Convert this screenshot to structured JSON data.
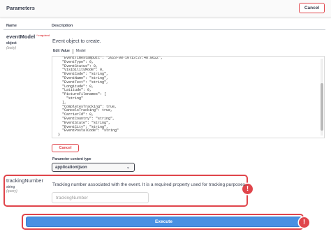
{
  "header": {
    "title": "Parameters",
    "cancel_label": "Cancel"
  },
  "columns": {
    "name": "Name",
    "description": "Description"
  },
  "event_model": {
    "name": "eventModel",
    "required_label": "* required",
    "type": "object",
    "in": "(body)",
    "description": "Event object to create.",
    "tabs": [
      "Edit Value",
      "Model"
    ],
    "code_lines": [
      "  \"EventTimestampUtc\": \"2023-08-10T13:27:48.862Z\",",
      "  \"EventType\": 0,",
      "  \"EventStatus\": 0,",
      "  \"VisibilityMode\": 0,",
      "  \"EventCode\": \"string\",",
      "  \"EventName\": \"string\",",
      "  \"EventText\": \"string\",",
      "  \"Longitude\": 0,",
      "  \"Latitude\": 0,",
      "  \"PictureFilenames\": [",
      "    \"string\"",
      "  ],",
      "  \"CompletesTracking\": true,",
      "  \"CancelsTracking\": true,",
      "  \"CarrierId\": 0,",
      "  \"EventCountry\": \"string\",",
      "  \"EventState\": \"string\",",
      "  \"EventCity\": \"string\",",
      "  \"EventPostalCode\": \"string\"",
      "}"
    ],
    "cancel_label": "Cancel",
    "content_type_label": "Parameter content type",
    "content_type_value": "application/json"
  },
  "tracking_number": {
    "name": "trackingNumber",
    "type": "string",
    "in": "(query)",
    "description": "Tracking number associated with the event. It is a required property used for tracking purposes.",
    "placeholder": "trackingNumber"
  },
  "execute_label": "Execute",
  "alert_symbol": "!",
  "colors": {
    "accent_red": "#e0454b",
    "execute_blue": "#4990e2"
  },
  "icons": {
    "select": "chevron-down-icon",
    "alert": "exclamation-icon"
  }
}
